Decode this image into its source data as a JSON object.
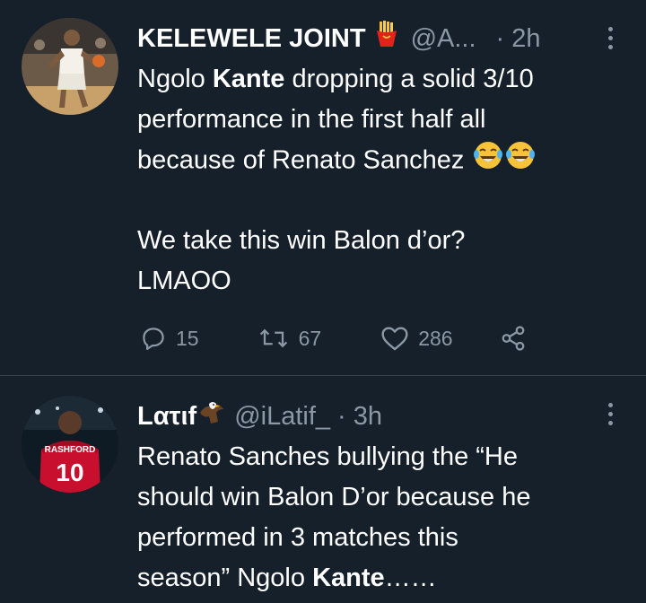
{
  "tweets": [
    {
      "author_name": "KELEWELE JOINT",
      "name_emoji": "fries-emoji",
      "handle": "@A...",
      "time": "· 2h",
      "lines": [
        {
          "pre": "Ngolo ",
          "bold": "Kante",
          "post": " dropping a solid 3/10"
        },
        {
          "pre": "performance in the first half all",
          "bold": "",
          "post": ""
        },
        {
          "pre": "because of Renato Sanchez ",
          "bold": "",
          "post": ""
        },
        {
          "pre": "",
          "bold": "",
          "post": ""
        },
        {
          "pre": "We take this win Balon d’or?",
          "bold": "",
          "post": ""
        },
        {
          "pre": "LMAOO",
          "bold": "",
          "post": ""
        }
      ],
      "trailing_emoji": "laughing-tears-emoji x2",
      "reply_count": "15",
      "retweet_count": "67",
      "like_count": "286"
    },
    {
      "author_name": "Lατιf",
      "name_emoji": "eagle-emoji",
      "handle": "@iLatif_",
      "time": "· 3h",
      "lines": [
        {
          "pre": "Renato Sanches bullying the “He",
          "bold": "",
          "post": ""
        },
        {
          "pre": "should win Balon D’or because he",
          "bold": "",
          "post": ""
        },
        {
          "pre": "performed in 3 matches this",
          "bold": "",
          "post": ""
        },
        {
          "pre": "season” Ngolo ",
          "bold": "Kante",
          "post": "……"
        }
      ],
      "avatar_jersey_name": "RASHFORD",
      "avatar_jersey_number": "10"
    }
  ],
  "colors": {
    "background": "#15202b",
    "text": "#ffffff",
    "secondary": "#8b98a5",
    "divider": "#38444d"
  }
}
